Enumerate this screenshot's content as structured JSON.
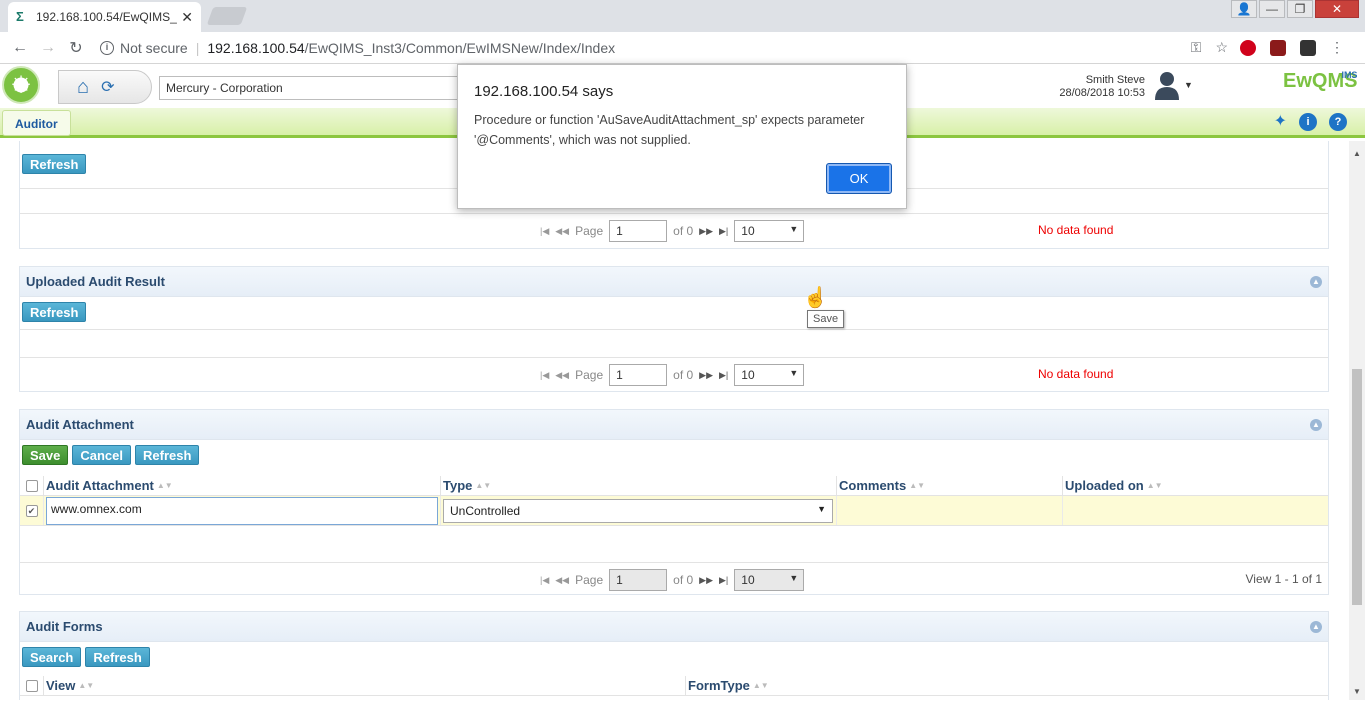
{
  "browser": {
    "tab_title": "192.168.100.54/EwQIMS_",
    "not_secure": "Not secure",
    "url_host": "192.168.100.54",
    "url_path": "/EwQIMS_Inst3/Common/EwIMSNew/Index/Index"
  },
  "app": {
    "company": "Mercury - Corporation",
    "user_name": "Smith Steve",
    "datetime": "28/08/2018 10:53",
    "logo_text": "EwQMS",
    "logo_super": "IMS",
    "nav_tab": "Auditor"
  },
  "top_panel": {
    "refresh_label": "Refresh",
    "page_label": "Page",
    "page_value": "1",
    "of_label": "of 0",
    "page_size": "10",
    "status": "No data found"
  },
  "uploaded_result": {
    "title": "Uploaded Audit Result",
    "refresh_label": "Refresh",
    "page_label": "Page",
    "page_value": "1",
    "of_label": "of 0",
    "page_size": "10",
    "status": "No data found"
  },
  "attachment": {
    "title": "Audit Attachment",
    "save_label": "Save",
    "cancel_label": "Cancel",
    "refresh_label": "Refresh",
    "columns": [
      "Audit Attachment",
      "Type",
      "Comments",
      "Uploaded on"
    ],
    "row": {
      "attachment": "www.omnex.com",
      "type": "UnControlled",
      "comments": "",
      "uploaded_on": ""
    },
    "page_label": "Page",
    "page_value": "1",
    "of_label": "of 0",
    "page_size": "10",
    "view_info": "View 1 - 1 of 1"
  },
  "forms": {
    "title": "Audit Forms",
    "search_label": "Search",
    "refresh_label": "Refresh",
    "columns": [
      "View",
      "FormType"
    ]
  },
  "dialog": {
    "title": "192.168.100.54 says",
    "message": "Procedure or function 'AuSaveAuditAttachment_sp' expects parameter '@Comments', which was not supplied.",
    "ok_label": "OK"
  },
  "tooltip": "Save"
}
